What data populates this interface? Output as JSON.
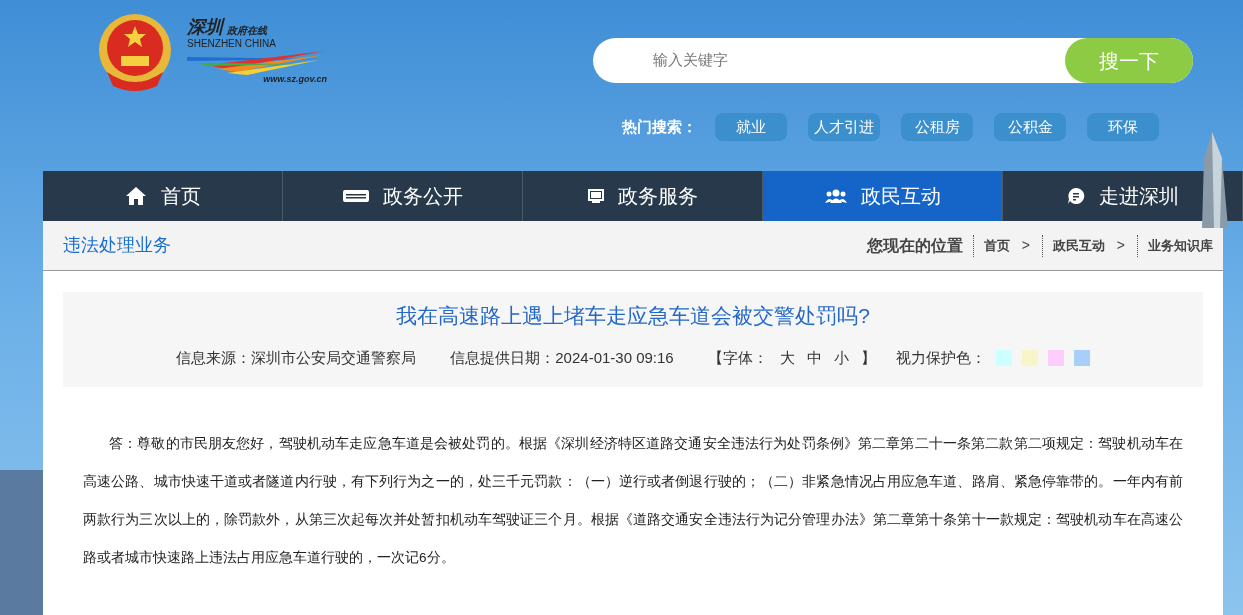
{
  "header": {
    "logo": {
      "title": "深圳",
      "subtitle": "政府在线",
      "english": "SHENZHEN CHINA",
      "url": "www.sz.gov.cn"
    },
    "search": {
      "placeholder": "输入关键字",
      "button": "搜一下"
    },
    "hot_search": {
      "label": "热门搜索：",
      "tags": [
        "就业",
        "人才引进",
        "公租房",
        "公积金",
        "环保"
      ]
    }
  },
  "nav": [
    {
      "label": "首页",
      "selected": false
    },
    {
      "label": "政务公开",
      "selected": false
    },
    {
      "label": "政务服务",
      "selected": false
    },
    {
      "label": "政民互动",
      "selected": true
    },
    {
      "label": "走进深圳",
      "selected": false
    }
  ],
  "section_title": "违法处理业务",
  "breadcrumb": {
    "label": "您现在的位置",
    "items": [
      "首页",
      "政民互动",
      "业务知识库"
    ],
    "separator": ">"
  },
  "article": {
    "title": "我在高速路上遇上堵车走应急车道会被交警处罚吗?",
    "source": "信息来源：深圳市公安局交通警察局",
    "date": "信息提供日期：2024-01-30 09:16",
    "font_size": {
      "open": "【字体：",
      "sizes": [
        "大",
        "中",
        "小"
      ],
      "close": "】"
    },
    "eye_care": {
      "label": "视力保护色：",
      "swatches": [
        {
          "color": "#ccffff"
        },
        {
          "color": "#f8f5c8"
        },
        {
          "color": "#ffccff"
        },
        {
          "color": "#a6d0f8"
        }
      ]
    },
    "body": "答：尊敬的市民朋友您好，驾驶机动车走应急车道是会被处罚的。根据《深圳经济特区道路交通安全违法行为处罚条例》第二章第二十一条第二款第二项规定：驾驶机动车在高速公路、城市快速干道或者隧道内行驶，有下列行为之一的，处三千元罚款：（一）逆行或者倒退行驶的；（二）非紧急情况占用应急车道、路肩、紧急停靠带的。一年内有前两款行为三次以上的，除罚款外，从第三次起每次并处暂扣机动车驾驶证三个月。根据《道路交通安全违法行为记分管理办法》第二章第十条第十一款规定：驾驶机动车在高速公路或者城市快速路上违法占用应急车道行驶的，一次记6分。"
  }
}
